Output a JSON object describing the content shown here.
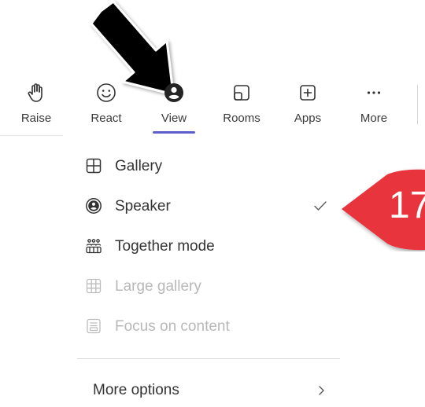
{
  "toolbar": {
    "items": [
      {
        "label": "Raise",
        "icon": "hand-icon"
      },
      {
        "label": "React",
        "icon": "smiley-icon"
      },
      {
        "label": "View",
        "icon": "person-circle-icon",
        "active": true
      },
      {
        "label": "Rooms",
        "icon": "rooms-icon"
      },
      {
        "label": "Apps",
        "icon": "plus-box-icon"
      },
      {
        "label": "More",
        "icon": "ellipsis-icon"
      }
    ],
    "accent_color": "#5b5fc7"
  },
  "view_menu": {
    "items": [
      {
        "label": "Gallery",
        "icon": "grid-icon",
        "enabled": true,
        "checked": false
      },
      {
        "label": "Speaker",
        "icon": "speaker-person-icon",
        "enabled": true,
        "checked": true
      },
      {
        "label": "Together mode",
        "icon": "together-mode-icon",
        "enabled": true,
        "checked": false
      },
      {
        "label": "Large gallery",
        "icon": "large-gallery-icon",
        "enabled": false,
        "checked": false
      },
      {
        "label": "Focus on content",
        "icon": "focus-content-icon",
        "enabled": false,
        "checked": false
      }
    ],
    "more_options": {
      "label": "More options",
      "icon": "chevron-right-icon"
    }
  },
  "callout": {
    "number": "17",
    "color": "#e8343c"
  }
}
